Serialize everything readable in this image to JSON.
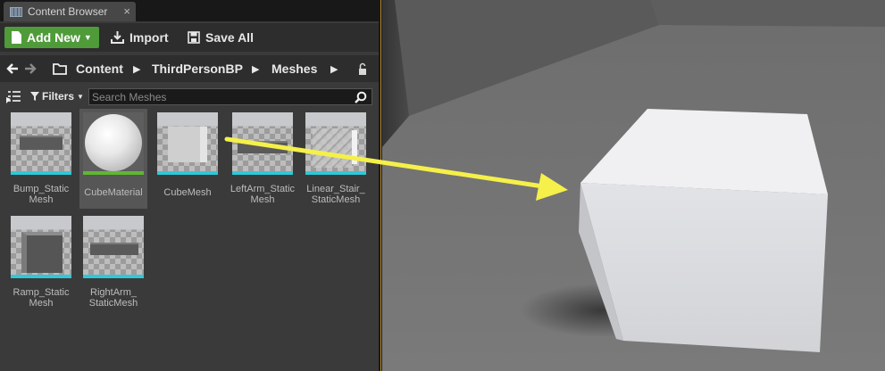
{
  "tab": {
    "title": "Content Browser",
    "close_glyph": "×"
  },
  "toolbar": {
    "add_new": "Add New",
    "import": "Import",
    "save_all": "Save All"
  },
  "path": {
    "items": [
      "Content",
      "ThirdPersonBP",
      "Meshes"
    ]
  },
  "filters": {
    "label": "Filters",
    "search_placeholder": "Search Meshes"
  },
  "assets": [
    {
      "name": "Bump_Static\nMesh",
      "kind": "mesh"
    },
    {
      "name": "CubeMaterial",
      "kind": "material"
    },
    {
      "name": "CubeMesh",
      "kind": "mesh"
    },
    {
      "name": "LeftArm_Static\nMesh",
      "kind": "mesh"
    },
    {
      "name": "Linear_Stair_\nStaticMesh",
      "kind": "mesh"
    },
    {
      "name": "Ramp_Static\nMesh",
      "kind": "mesh"
    },
    {
      "name": "RightArm_\nStaticMesh",
      "kind": "mesh"
    }
  ],
  "colors": {
    "add_new": "#4f9b3a",
    "mesh_bar": "#2fc8d8",
    "material_bar": "#5fb832",
    "arrow": "#f5f04a",
    "viewport_border": "#b58c2b"
  }
}
